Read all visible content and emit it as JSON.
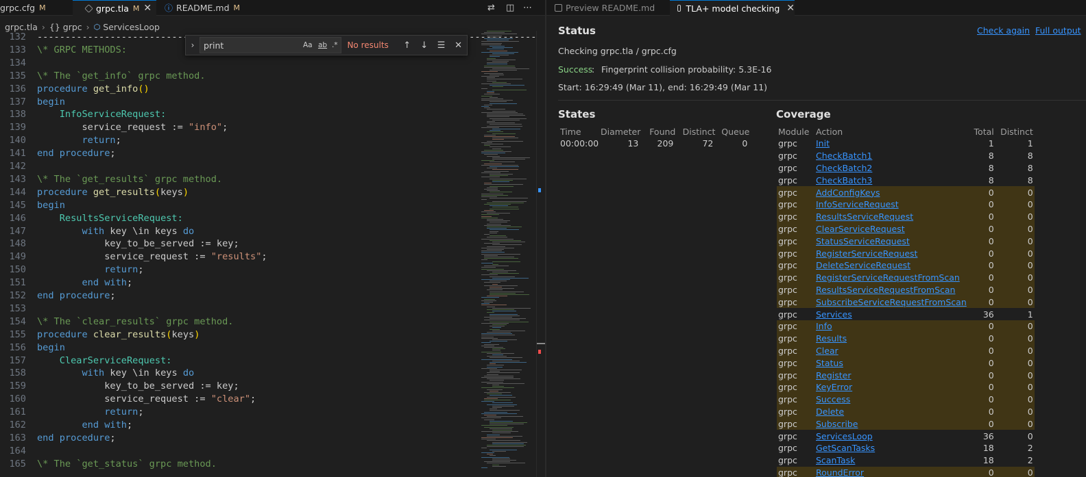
{
  "left_tabs": [
    {
      "label": "grpc.cfg",
      "mod": "M",
      "active": false
    },
    {
      "label": "grpc.tla",
      "mod": "M",
      "active": true
    },
    {
      "label": "README.md",
      "mod": "M",
      "active": false
    }
  ],
  "right_tabs": [
    {
      "label": "Preview README.md",
      "active": false
    },
    {
      "label": "TLA+ model checking",
      "active": true
    }
  ],
  "breadcrumb": [
    "grpc.tla",
    "{} grpc",
    "ServicesLoop"
  ],
  "find": {
    "value": "print",
    "result": "No results",
    "opt_case": "Aa",
    "opt_word": "ab",
    "opt_regex": ".*"
  },
  "code_lines": [
    {
      "n": "132",
      "html": "<span class='pl'>-----------------------------------------------------------------------------------------------------</span>"
    },
    {
      "n": "133",
      "html": "<span class='cm'>\\* GRPC METHODS:</span>"
    },
    {
      "n": "134",
      "html": ""
    },
    {
      "n": "135",
      "html": "<span class='cm'>\\* The `get_info` grpc method.</span>"
    },
    {
      "n": "136",
      "html": "<span class='kw'>procedure</span> <span class='fn'>get_info</span><span class='br'>()</span>"
    },
    {
      "n": "137",
      "html": "<span class='kw'>begin</span>"
    },
    {
      "n": "138",
      "html": "    <span class='lb'>InfoServiceRequest:</span>"
    },
    {
      "n": "139",
      "html": "        service_request := <span class='st'>\"info\"</span>;"
    },
    {
      "n": "140",
      "html": "        <span class='kw'>return</span>;"
    },
    {
      "n": "141",
      "html": "<span class='kw'>end procedure</span>;"
    },
    {
      "n": "142",
      "html": ""
    },
    {
      "n": "143",
      "html": "<span class='cm'>\\* The `get_results` grpc method.</span>"
    },
    {
      "n": "144",
      "html": "<span class='kw'>procedure</span> <span class='fn'>get_results</span><span class='br'>(</span>keys<span class='br'>)</span>"
    },
    {
      "n": "145",
      "html": "<span class='kw'>begin</span>"
    },
    {
      "n": "146",
      "html": "    <span class='lb'>ResultsServiceRequest:</span>"
    },
    {
      "n": "147",
      "html": "        <span class='kw'>with</span> key \\in keys <span class='kw'>do</span>"
    },
    {
      "n": "148",
      "html": "            key_to_be_served := key;"
    },
    {
      "n": "149",
      "html": "            service_request := <span class='st'>\"results\"</span>;"
    },
    {
      "n": "150",
      "html": "            <span class='kw'>return</span>;"
    },
    {
      "n": "151",
      "html": "        <span class='kw'>end with</span>;"
    },
    {
      "n": "152",
      "html": "<span class='kw'>end procedure</span>;"
    },
    {
      "n": "153",
      "html": ""
    },
    {
      "n": "154",
      "html": "<span class='cm'>\\* The `clear_results` grpc method.</span>"
    },
    {
      "n": "155",
      "html": "<span class='kw'>procedure</span> <span class='fn'>clear_results</span><span class='br'>(</span>keys<span class='br'>)</span>"
    },
    {
      "n": "156",
      "html": "<span class='kw'>begin</span>"
    },
    {
      "n": "157",
      "html": "    <span class='lb'>ClearServiceRequest:</span>"
    },
    {
      "n": "158",
      "html": "        <span class='kw'>with</span> key \\in keys <span class='kw'>do</span>"
    },
    {
      "n": "159",
      "html": "            key_to_be_served := key;"
    },
    {
      "n": "160",
      "html": "            service_request := <span class='st'>\"clear\"</span>;"
    },
    {
      "n": "161",
      "html": "            <span class='kw'>return</span>;"
    },
    {
      "n": "162",
      "html": "        <span class='kw'>end with</span>;"
    },
    {
      "n": "163",
      "html": "<span class='kw'>end procedure</span>;"
    },
    {
      "n": "164",
      "html": ""
    },
    {
      "n": "165",
      "html": "<span class='cm'>\\* The `get_status` grpc method.</span>"
    }
  ],
  "status": {
    "title": "Status",
    "check_again": "Check again",
    "full_output": "Full output",
    "checking": "Checking grpc.tla / grpc.cfg",
    "success_label": "Success",
    "success_sep": ":",
    "success_text": "Fingerprint collision probability: 5.3E-16",
    "times": "Start: 16:29:49 (Mar 11), end: 16:29:49 (Mar 11)"
  },
  "states": {
    "title": "States",
    "headers": [
      "Time",
      "Diameter",
      "Found",
      "Distinct",
      "Queue"
    ],
    "row": [
      "00:00:00",
      "13",
      "209",
      "72",
      "0"
    ]
  },
  "coverage": {
    "title": "Coverage",
    "headers": [
      "Module",
      "Action",
      "Total",
      "Distinct"
    ],
    "rows": [
      [
        "grpc",
        "Init",
        "1",
        "1"
      ],
      [
        "grpc",
        "CheckBatch1",
        "8",
        "8"
      ],
      [
        "grpc",
        "CheckBatch2",
        "8",
        "8"
      ],
      [
        "grpc",
        "CheckBatch3",
        "8",
        "8"
      ],
      [
        "grpc",
        "AddConfigKeys",
        "0",
        "0"
      ],
      [
        "grpc",
        "InfoServiceRequest",
        "0",
        "0"
      ],
      [
        "grpc",
        "ResultsServiceRequest",
        "0",
        "0"
      ],
      [
        "grpc",
        "ClearServiceRequest",
        "0",
        "0"
      ],
      [
        "grpc",
        "StatusServiceRequest",
        "0",
        "0"
      ],
      [
        "grpc",
        "RegisterServiceRequest",
        "0",
        "0"
      ],
      [
        "grpc",
        "DeleteServiceRequest",
        "0",
        "0"
      ],
      [
        "grpc",
        "RegisterServiceRequestFromScan",
        "0",
        "0"
      ],
      [
        "grpc",
        "ResultsServiceRequestFromScan",
        "0",
        "0"
      ],
      [
        "grpc",
        "SubscribeServiceRequestFromScan",
        "0",
        "0"
      ],
      [
        "grpc",
        "Services",
        "36",
        "1"
      ],
      [
        "grpc",
        "Info",
        "0",
        "0"
      ],
      [
        "grpc",
        "Results",
        "0",
        "0"
      ],
      [
        "grpc",
        "Clear",
        "0",
        "0"
      ],
      [
        "grpc",
        "Status",
        "0",
        "0"
      ],
      [
        "grpc",
        "Register",
        "0",
        "0"
      ],
      [
        "grpc",
        "KeyError",
        "0",
        "0"
      ],
      [
        "grpc",
        "Success",
        "0",
        "0"
      ],
      [
        "grpc",
        "Delete",
        "0",
        "0"
      ],
      [
        "grpc",
        "Subscribe",
        "0",
        "0"
      ],
      [
        "grpc",
        "ServicesLoop",
        "36",
        "0"
      ],
      [
        "grpc",
        "GetScanTasks",
        "18",
        "2"
      ],
      [
        "grpc",
        "ScanTask",
        "18",
        "2"
      ],
      [
        "grpc",
        "RoundError",
        "0",
        "0"
      ]
    ]
  },
  "colors": {
    "accent": "#3794ff",
    "success": "#89d185",
    "zero_row": "#403515",
    "modified": "#e2c08d"
  }
}
